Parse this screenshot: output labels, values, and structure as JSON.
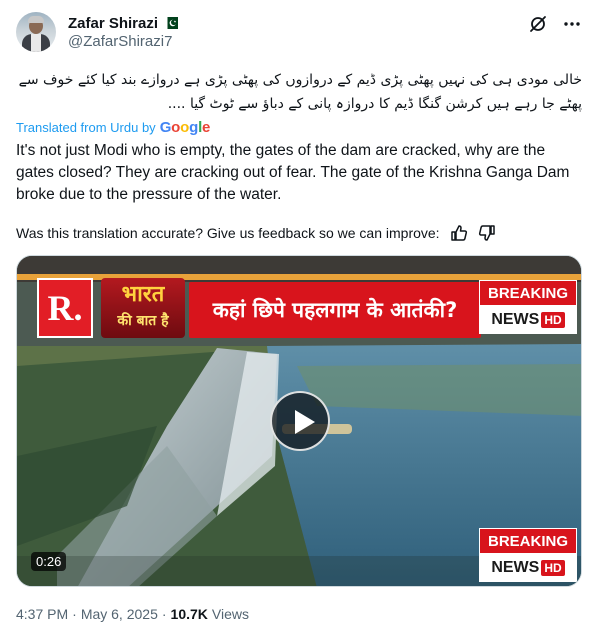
{
  "author": {
    "display_name": "Zafar Shirazi",
    "handle": "@ZafarShirazi7",
    "flag": "pakistan-flag-icon"
  },
  "header_icons": [
    "grok-icon",
    "more-icon"
  ],
  "tweet": {
    "urdu_text": "خالی مودی ہی کی نہیں پھٹی پڑی ڈیم کے دروازوں کی پھٹی پڑی ہے دروازے بند کیا کئے خوف سے پھٹے جا رہے ہیں کرشن گنگا ڈیم کا دروازہ پانی کے دباؤ سے ٹوٹ گیا ....",
    "translated_from": "Translated from Urdu by",
    "google_letters": [
      "G",
      "o",
      "o",
      "g",
      "l",
      "e"
    ],
    "translation": "It's not just Modi who is empty, the gates of the dam are cracked, why are the gates closed? They are cracking out of fear. The gate of the Krishna Ganga Dam broke due to the pressure of the water.",
    "feedback_prompt": "Was this translation accurate? Give us feedback so we can improve:"
  },
  "video": {
    "channel_logo": "R.",
    "show_logo_line1": "भारत",
    "show_logo_line2": "की बात है",
    "headline": "कहां छिपे पहलगाम के आतंकी?",
    "breaking_label": "BREAKING",
    "news_label": "NEWS",
    "hd_label": "HD",
    "duration": "0:26"
  },
  "meta": {
    "time": "4:37 PM",
    "date": "May 6, 2025",
    "views_count": "10.7K",
    "views_label": "Views"
  },
  "colors": {
    "link_blue": "#1d9bf0",
    "secondary_text": "#536471",
    "breaking_red": "#d8141c"
  }
}
